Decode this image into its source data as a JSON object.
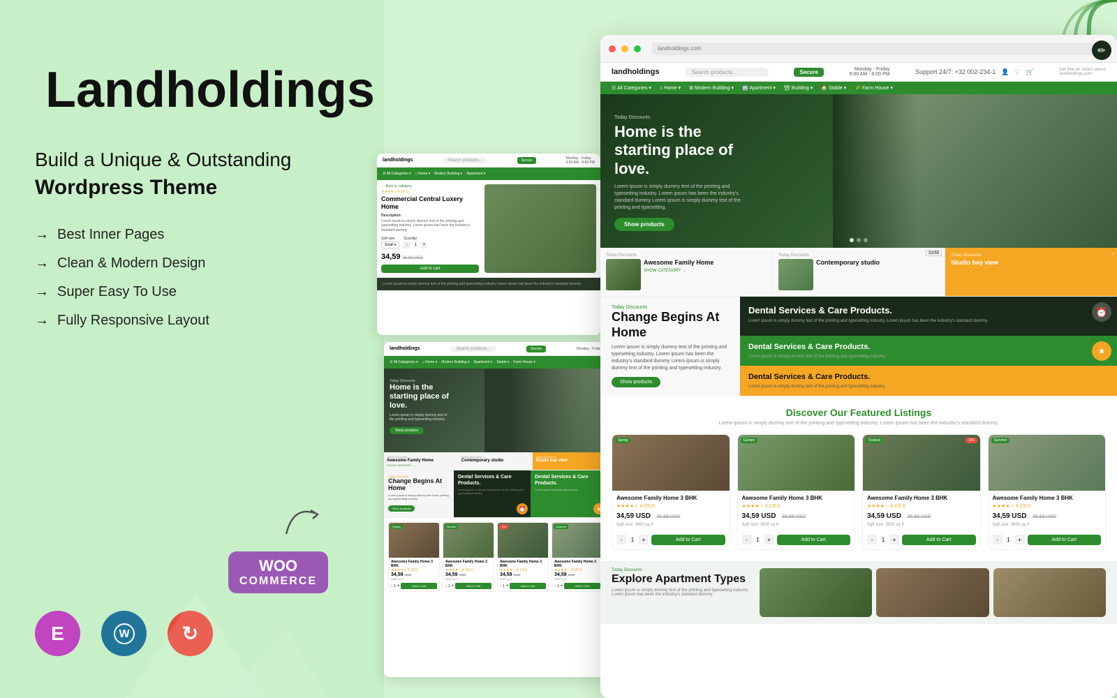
{
  "brand": {
    "name": "Landholdings",
    "tagline_line1": "Build a Unique & Outstanding",
    "tagline_line2": "Wordpress Theme"
  },
  "features": [
    "Best Inner Pages",
    "Clean & Modern Design",
    "Super Easy To Use",
    "Fully Responsive Layout"
  ],
  "tech": [
    {
      "name": "Elementor",
      "symbol": "E"
    },
    {
      "name": "WordPress",
      "symbol": "W"
    },
    {
      "name": "Update",
      "symbol": "↻"
    }
  ],
  "woo": {
    "line1": "WOO",
    "line2": "COMMERCE"
  },
  "demo": {
    "site_name": "landholdings",
    "nav_items": [
      "All Categories",
      "Home",
      "Modern Building",
      "Apartment",
      "Building",
      "Stable",
      "Farm House"
    ],
    "hero": {
      "today": "Today Discounts",
      "title": "Home is the starting place of love.",
      "description": "Lorem ipsum is simply dummy text of the printing and typesetting industry. Lorem ipsum has been the industry's standard dummy Lorem ipsum is simply dummy text of the printing and typesetting.",
      "btn_label": "Show products"
    },
    "property_cards": [
      {
        "today": "Today Discounts",
        "title": "Awesome Family Home",
        "show": "SHOW CATEGORY →"
      },
      {
        "today": "Today Discounts",
        "title": "Contemporary studio",
        "show": ""
      },
      {
        "today": "Today Discounts",
        "title": "Studio bay view",
        "show": "",
        "orange": true
      }
    ],
    "change_block": {
      "today": "Today Discounts",
      "title": "Change Begins At Home",
      "description": "Lorem ipsum is simply dummy text of the printing and typesetting industry. Lorem ipsum has been the industry's standard dummy Lorem ipsum is simply dummy text of the printing and typesetting industry.",
      "btn_label": "Show products"
    },
    "dental_cards": [
      {
        "type": "dark",
        "title": "Dental Services & Care Products.",
        "description": "Lorem ipsum is simply dummy text of the printing and typesetting industry. Lorem ipsum has been the industry's standard dummy.",
        "icon": "⏰"
      },
      {
        "type": "green",
        "title": "Dental Services & Care Products.",
        "description": "Lorem ipsum is simply dummy text of the printing and typesetting industry. Lorem ipsum has been the industry's standard dummy.",
        "icon": "★"
      },
      {
        "type": "orange",
        "title": "Dental Services & Care Products.",
        "description": "Lorem ipsum is simply dummy text of the printing and typesetting industry.",
        "icon": "✏"
      }
    ],
    "featured": {
      "title": "Discover Our Featured Listings",
      "description": "Lorem ipsum is simply dummy text of the printing and typesetting industry. Lorem ipsum has been the industry's standard dummy.",
      "listings": [
        {
          "name": "Awesome Family Home 3 BHK",
          "badge": "Spring",
          "badge2": "",
          "stars": "★★★★☆ 4.2/5.0",
          "price": "34,59",
          "currency": "USD",
          "old_price": "36,89 USD",
          "sqft": "3950 sq ft",
          "btn": "Add to Cart"
        },
        {
          "name": "Awesome Family Home 3 BHK",
          "badge": "Garden",
          "badge2": "",
          "stars": "★★★★☆ 4.2/5.0",
          "price": "34,59",
          "currency": "USD",
          "old_price": "36,89 USD",
          "sqft": "3950 sq ft",
          "btn": "Add to Cart"
        },
        {
          "name": "Awesome Family Home 3 BHK",
          "badge": "Feature",
          "badge2": "-5%",
          "stars": "★★★★☆ 4.2/5.0",
          "price": "34,59",
          "currency": "USD",
          "old_price": "36,89 USD",
          "sqft": "3925 sq ft",
          "btn": "Add to Cart"
        },
        {
          "name": "Awesome Family Home 3 BHK",
          "badge": "Summer",
          "badge2": "",
          "stars": "★★★★☆ 4.2/5.0",
          "price": "34,59",
          "currency": "USD",
          "old_price": "36,89 USD",
          "sqft": "3950 sq ft",
          "btn": "Add to Cart"
        }
      ]
    },
    "explore": {
      "today": "Today Discounts",
      "title": "Explore Apartment Types",
      "description": "Lorem ipsum is simply dummy text of the printing and typesetting industry. Lorem ipsum has been the industry's standard dummy."
    }
  },
  "colors": {
    "green": "#2d8c2d",
    "dark_green": "#1a3a1a",
    "orange": "#f5a623",
    "dark": "#1a2a1a"
  }
}
